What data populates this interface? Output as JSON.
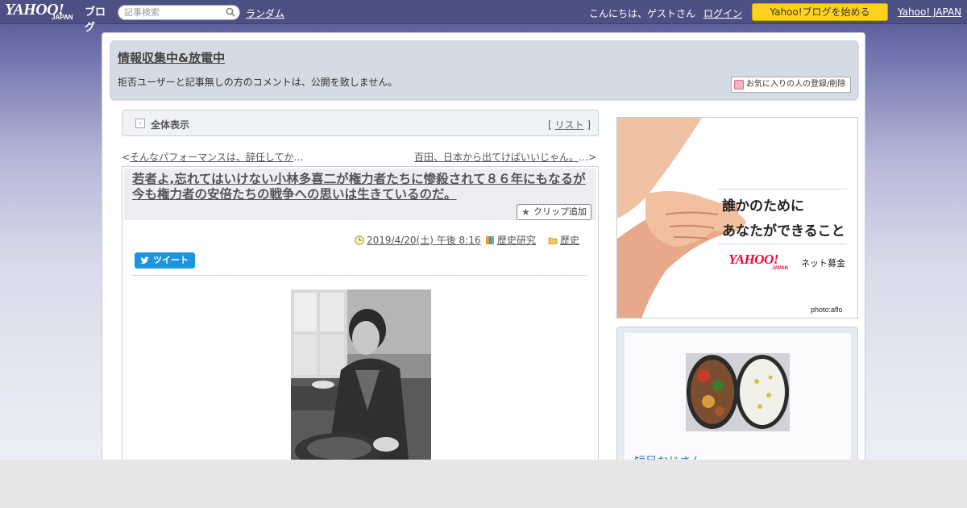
{
  "topbar": {
    "logo_text": "YAHOO!",
    "logo_sub": "JAPAN",
    "logo_blog": "ブログ",
    "search_placeholder": "記事検索",
    "random_link": "ランダム",
    "greeting": "こんにちは、ゲストさん",
    "login_link": "ログイン",
    "start_button": "Yahoo!ブログを始める",
    "yahoo_japan_link": "Yahoo! JAPAN"
  },
  "blog": {
    "title": "情報収集中&放電中",
    "description": "拒否ユーザーと記事無しの方のコメントは、公開を致しません。",
    "favorite_button": "お気に入りの人の登録/削除"
  },
  "view_bar": {
    "label": "全体表示",
    "list_open": "[ ",
    "list_link": "リスト",
    "list_close": " ]"
  },
  "navigation": {
    "prev_arrow": "<",
    "prev_title": "そんなパフォーマンスは、辞任してか",
    "prev_ellipsis": "…",
    "next_title": "百田、日本から出てけばいいじゃん。",
    "next_ellipsis": "…>"
  },
  "article": {
    "title": "若者よ,忘れてはいけない小林多喜二が権力者たちに惨殺されて８６年にもなるが今も権力者の安倍たちの戦争への思いは生きているのだ。",
    "clip_button": "クリップ追加",
    "date": "2019/4/20(土) 午後 8:16",
    "category": "歴史研究",
    "folder": "歴史",
    "tweet_button": "ツイート"
  },
  "sidebar": {
    "ad": {
      "line1": "誰かのために",
      "line2": "あなたができること",
      "brand": "YAHOO!",
      "brand_sub": "JAPAN",
      "service": "ネット募金",
      "credit": "photo:aflo"
    },
    "profile": {
      "name": "短足おじさん"
    }
  }
}
